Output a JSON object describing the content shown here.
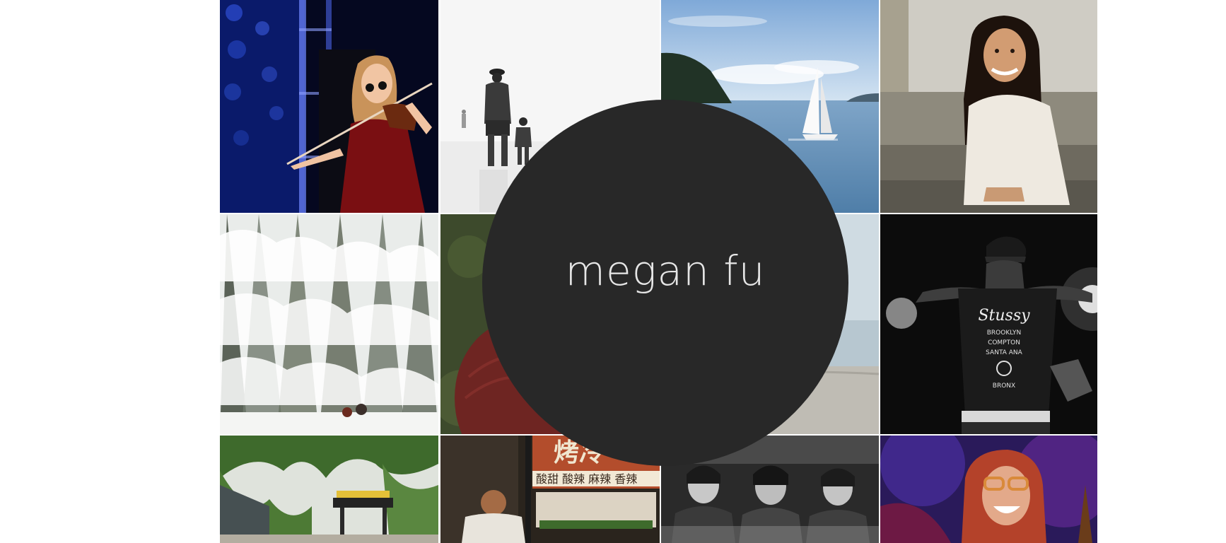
{
  "site": {
    "title": "megan fu"
  },
  "photo_grid": {
    "tiles": [
      {
        "name": "photo-violinist",
        "subject": "violinist on stage with blue lights"
      },
      {
        "name": "photo-beach-father-child",
        "subject": "father and child on misty beach"
      },
      {
        "name": "photo-sailboat",
        "subject": "sailboat on calm bay"
      },
      {
        "name": "photo-portrait-smiling",
        "subject": "smiling woman in white sweater"
      },
      {
        "name": "photo-snowy-forest",
        "subject": "snow covered forest"
      },
      {
        "name": "photo-red-knit-hat",
        "subject": "red knit hat in forest"
      },
      {
        "name": "photo-hazy-shore",
        "subject": "hazy shoreline"
      },
      {
        "name": "photo-concert-guitarist",
        "subject": "performer in black and white"
      },
      {
        "name": "photo-willow-park",
        "subject": "willow trees and pavilion"
      },
      {
        "name": "photo-market-stall",
        "subject": "street food stall"
      },
      {
        "name": "photo-vintage-trio",
        "subject": "vintage black and white portraits"
      },
      {
        "name": "photo-laughing-singer",
        "subject": "laughing singer with glasses"
      }
    ]
  },
  "street_sign": {
    "lines": [
      "烤冷",
      "酸甜 酸辣 麻辣 香辣"
    ]
  },
  "shirt_text": {
    "lines": [
      "Stussy",
      "BROOKLYN",
      "COMPTON",
      "SANTA ANA",
      "BRONX"
    ]
  },
  "colors": {
    "circle": "#282828",
    "title_text": "#e6e6e6",
    "page_background": "#ffffff"
  }
}
